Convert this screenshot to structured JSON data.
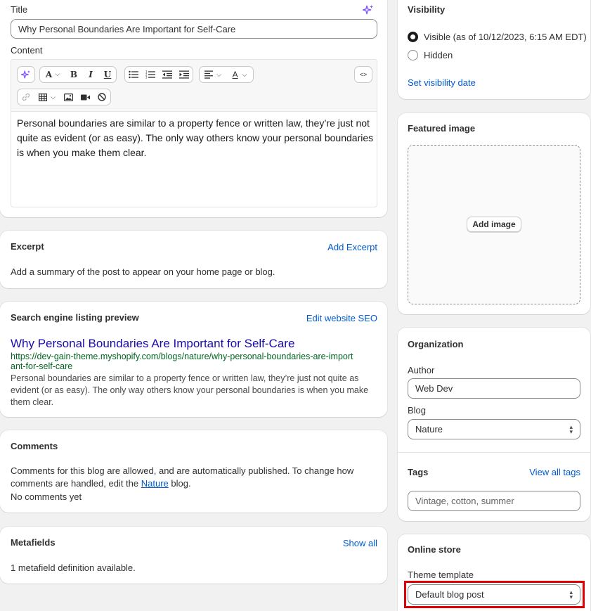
{
  "post": {
    "title_label": "Title",
    "title_value": "Why Personal Boundaries Are Important for Self-Care",
    "content_label": "Content",
    "content_text": "Personal boundaries are similar to a property fence or written law, they’re just not quite as evident (or as easy). The only way others know your personal boundaries is when you make them clear.",
    "toolbar": {
      "font_a": "A",
      "bold": "B",
      "italic": "I",
      "underline": "U",
      "code": "<>",
      "text_color": "A"
    }
  },
  "excerpt": {
    "heading": "Excerpt",
    "action": "Add Excerpt",
    "description": "Add a summary of the post to appear on your home page or blog."
  },
  "seo": {
    "heading": "Search engine listing preview",
    "action": "Edit website SEO",
    "preview_title": "Why Personal Boundaries Are Important for Self-Care",
    "preview_url": "https://dev-gain-theme.myshopify.com/blogs/nature/why-personal-boundaries-are-important-for-self-care",
    "preview_description": "Personal boundaries are similar to a property fence or written law, they’re just not quite as evident (or as easy). The only way others know your personal boundaries is when you make them clear."
  },
  "comments": {
    "heading": "Comments",
    "text_before": "Comments for this blog are allowed, and are automatically published. To change how comments are handled, edit the",
    "blog_link": "Nature",
    "text_after": "blog.",
    "status": "No comments yet"
  },
  "metafields": {
    "heading": "Metafields",
    "action": "Show all",
    "description": "1 metafield definition available."
  },
  "visibility": {
    "heading": "Visibility",
    "options": [
      {
        "label": "Visible (as of 10/12/2023, 6:15 AM EDT)",
        "checked": true
      },
      {
        "label": "Hidden",
        "checked": false
      }
    ],
    "action": "Set visibility date"
  },
  "featured_image": {
    "heading": "Featured image",
    "button": "Add image"
  },
  "organization": {
    "heading": "Organization",
    "author_label": "Author",
    "author_value": "Web Dev",
    "blog_label": "Blog",
    "blog_value": "Nature",
    "tags_heading": "Tags",
    "tags_action": "View all tags",
    "tags_placeholder": "Vintage, cotton, summer"
  },
  "online_store": {
    "heading": "Online store",
    "template_label": "Theme template",
    "template_value": "Default blog post"
  },
  "colors": {
    "link": "#005bd3",
    "seo_title": "#1a0dab",
    "seo_url": "#006621",
    "highlight": "#e00000",
    "magic": "#8051ff"
  }
}
